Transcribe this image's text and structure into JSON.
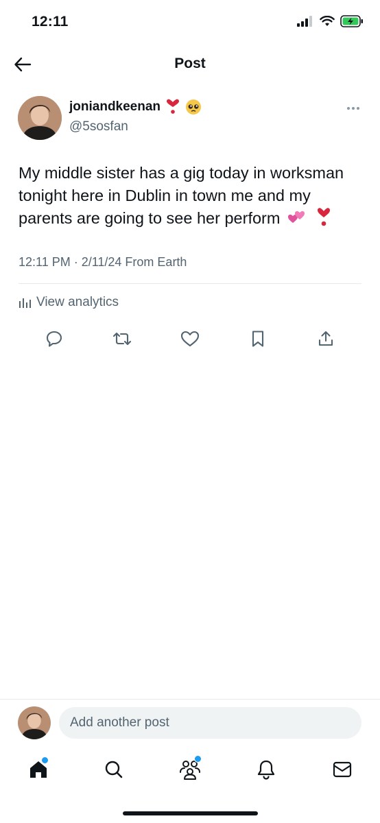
{
  "status_bar": {
    "time": "12:11"
  },
  "header": {
    "title": "Post"
  },
  "post": {
    "display_name": "joniandkeenan",
    "name_emojis": [
      "heart-exclamation-emoji",
      "pleading-face-emoji"
    ],
    "handle": "@5sosfan",
    "text_lines": [
      "My middle sister has a gig today in worksman",
      "tonight here in Dublin in town me and my",
      "parents are going to see her perform"
    ],
    "text_emojis": [
      "revolving-hearts-emoji",
      "heart-exclamation-emoji"
    ],
    "timestamp": "12:11 PM · 2/11/24 From Earth",
    "analytics_label": "View analytics"
  },
  "actions": [
    "reply-icon",
    "repost-icon",
    "like-icon",
    "bookmark-icon",
    "share-icon"
  ],
  "composer": {
    "placeholder": "Add another post"
  },
  "tab_bar": [
    "home-icon",
    "search-icon",
    "communities-icon",
    "notifications-icon",
    "messages-icon"
  ],
  "colors": {
    "text": "#0f1419",
    "secondary": "#536471",
    "accent": "#1d9bf0",
    "input_bg": "#eff3f4",
    "divider": "#e7e9ea"
  }
}
